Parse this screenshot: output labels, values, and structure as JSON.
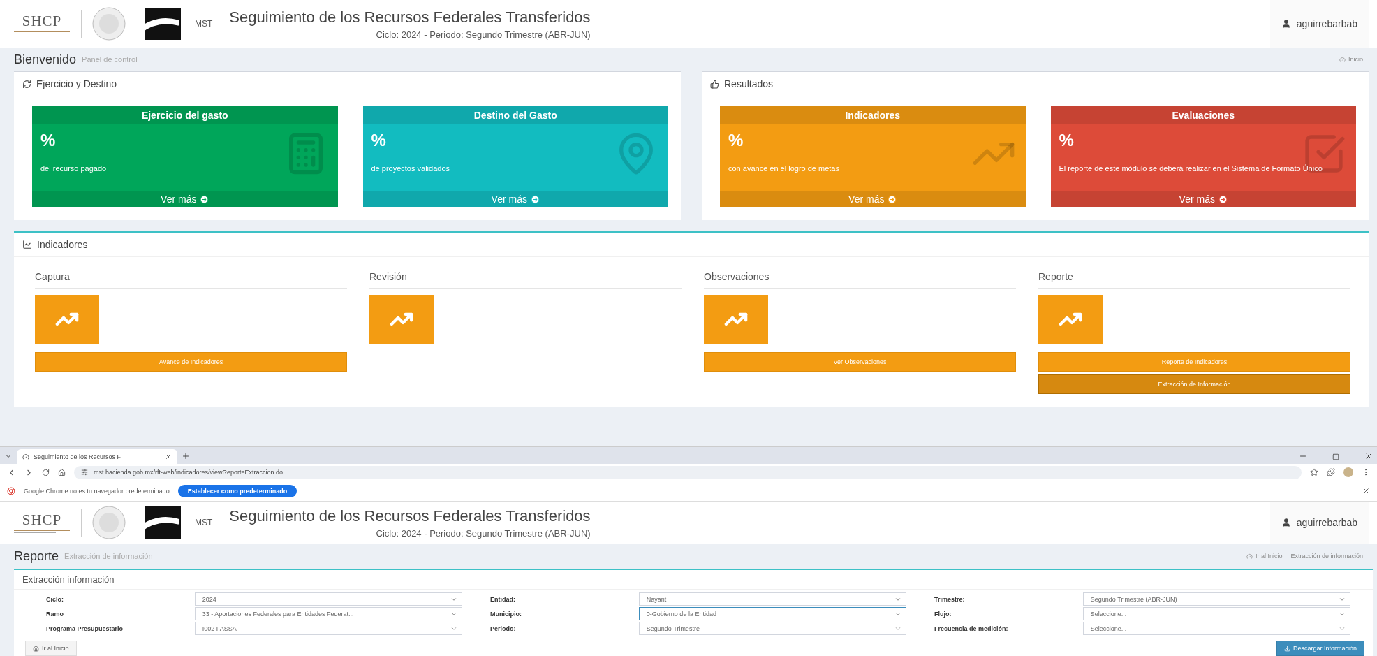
{
  "dashboard": {
    "header": {
      "logo": "SHCP",
      "app": "MST",
      "title": "Seguimiento de los Recursos Federales Transferidos",
      "subtitle": "Ciclo: 2024 - Periodo: Segundo Trimestre (ABR-JUN)",
      "user": "aguirrebarbab"
    },
    "page_title": "Bienvenido",
    "page_subtitle": "Panel de control",
    "breadcrumb": "Inicio",
    "sections": [
      {
        "title": "Ejercicio y Destino",
        "kind": "refresh",
        "cards": [
          {
            "title": "Ejercicio del gasto",
            "value": "%",
            "caption": "del recurso pagado",
            "link": "Ver más",
            "color": "#00a65a",
            "kind": "calculator"
          },
          {
            "title": "Destino del Gasto",
            "value": "%",
            "caption": "de proyectos validados",
            "link": "Ver más",
            "color": "#12bcc0",
            "kind": "pin"
          }
        ]
      },
      {
        "title": "Resultados",
        "kind": "thumb",
        "cards": [
          {
            "title": "Indicadores",
            "value": "%",
            "caption": "con avance en el logro de metas",
            "link": "Ver más",
            "color": "#f39c12",
            "kind": "chart"
          },
          {
            "title": "Evaluaciones",
            "value": "%",
            "caption": "El reporte de este módulo se deberá realizar en el Sistema de Formato Único",
            "link": "Ver más",
            "color": "#dd4b39",
            "kind": "check"
          }
        ]
      }
    ],
    "indicadores": {
      "title": "Indicadores",
      "columns": [
        {
          "title": "Captura",
          "buttons": [
            {
              "label": "Avance de Indicadores",
              "kind": "normal"
            }
          ]
        },
        {
          "title": "Revisión"
        },
        {
          "title": "Observaciones",
          "buttons": [
            {
              "label": "Ver Observaciones",
              "kind": "normal"
            }
          ]
        },
        {
          "title": "Reporte",
          "buttons": [
            {
              "label": "Reporte de Indicadores",
              "kind": "normal"
            },
            {
              "label": "Extracción de Información",
              "kind": "dark"
            }
          ]
        }
      ]
    }
  },
  "browser": {
    "tab_title": "Seguimiento de los Recursos F",
    "url": "mst.hacienda.gob.mx/rft-web/indicadores/viewReporteExtraccion.do",
    "infobar_text": "Google Chrome no es tu navegador predeterminado",
    "infobar_button": "Establecer como predeterminado"
  },
  "report": {
    "header": {
      "logo": "SHCP",
      "app": "MST",
      "title": "Seguimiento de los Recursos Federales Transferidos",
      "subtitle": "Ciclo: 2024 - Periodo: Segundo Trimestre (ABR-JUN)",
      "user": "aguirrebarbab"
    },
    "page_title": "Reporte",
    "page_subtitle": "Extracción de información",
    "breadcrumbs": [
      "Ir al Inicio",
      "Extracción de información"
    ],
    "form_title": "Extracción información",
    "columns": [
      [
        {
          "label": "Ciclo:",
          "value": "2024",
          "focused": false
        },
        {
          "label": "Ramo",
          "value": "33 - Aportaciones Federales para Entidades Federat...",
          "focused": false
        },
        {
          "label": "Programa Presupuestario",
          "value": "I002 FASSA",
          "focused": false
        }
      ],
      [
        {
          "label": "Entidad:",
          "value": "Nayarit",
          "focused": false
        },
        {
          "label": "Municipio:",
          "value": "0-Gobierno de la Entidad",
          "focused": true
        },
        {
          "label": "Periodo:",
          "value": "Segundo Trimestre",
          "focused": false
        }
      ],
      [
        {
          "label": "Trimestre:",
          "value": "Segundo Trimestre (ABR-JUN)",
          "focused": false
        },
        {
          "label": "Flujo:",
          "value": "Seleccione...",
          "focused": false
        },
        {
          "label": "Frecuencia de medición:",
          "value": "Seleccione...",
          "focused": false
        }
      ]
    ],
    "back_button": "Ir al Inicio",
    "download_button": "Descargar Información"
  }
}
